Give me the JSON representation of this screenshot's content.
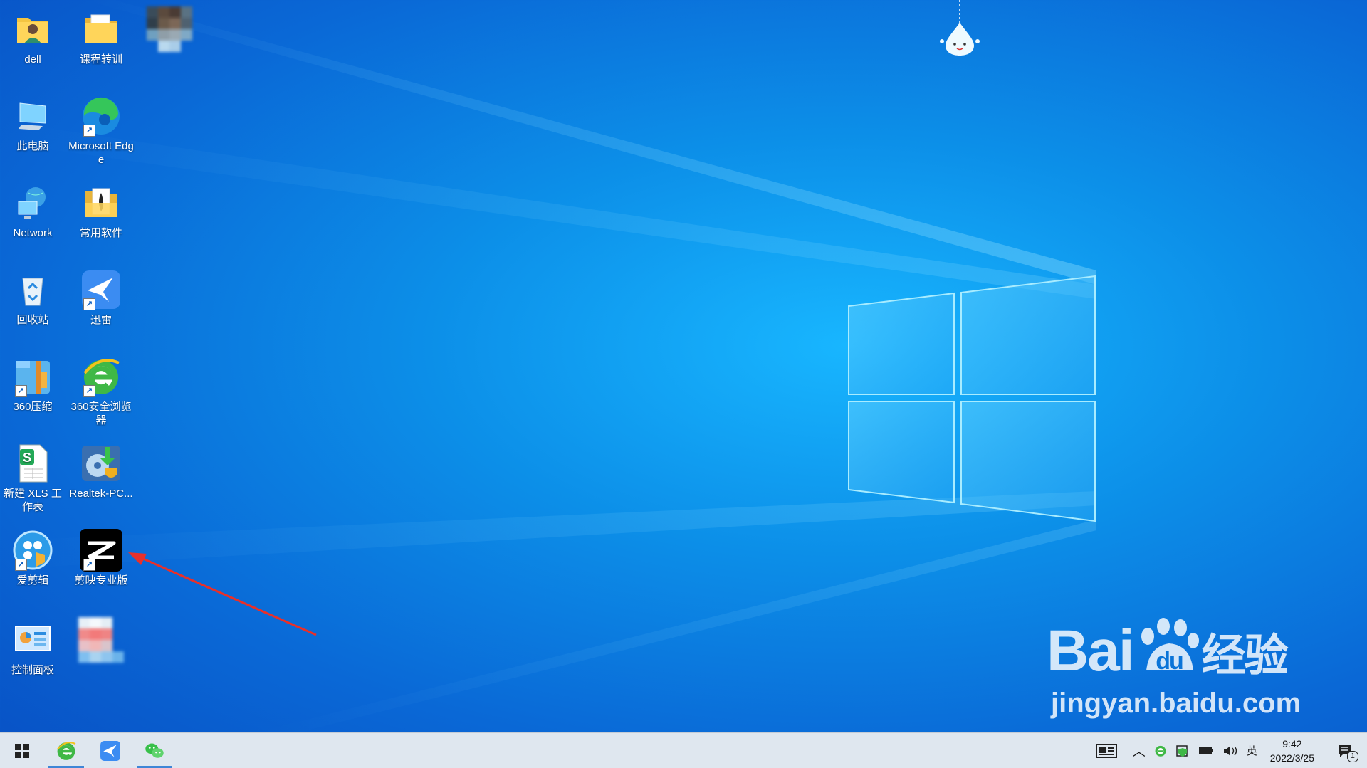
{
  "desktop": {
    "icons": [
      {
        "label": "dell",
        "icon": "user-folder-icon"
      },
      {
        "label": "课程转训",
        "icon": "folder-icon"
      },
      {
        "label": "",
        "icon": "blurred-image-icon"
      },
      {
        "label": "此电脑",
        "icon": "computer-icon"
      },
      {
        "label": "Microsoft Edge",
        "icon": "edge-icon"
      },
      {
        "label": "Network",
        "icon": "network-icon"
      },
      {
        "label": "常用软件",
        "icon": "folder-icon"
      },
      {
        "label": "回收站",
        "icon": "recycle-bin-icon"
      },
      {
        "label": "迅雷",
        "icon": "xunlei-icon"
      },
      {
        "label": "360压缩",
        "icon": "360zip-icon"
      },
      {
        "label": "360安全浏览器",
        "icon": "360browser-icon"
      },
      {
        "label": "新建 XLS 工作表",
        "icon": "spreadsheet-icon"
      },
      {
        "label": "Realtek-PC...",
        "icon": "realtek-icon"
      },
      {
        "label": "爱剪辑",
        "icon": "aijianji-icon"
      },
      {
        "label": "剪映专业版",
        "icon": "capcut-icon"
      },
      {
        "label": "控制面板",
        "icon": "control-panel-icon"
      },
      {
        "label": "",
        "icon": "blurred-image-icon"
      }
    ]
  },
  "watermark": {
    "brand": "Bai",
    "brand_tail": "经验",
    "url": "jingyan.baidu.com"
  },
  "taskbar": {
    "pinned": [
      "start-icon",
      "360browser-icon",
      "xunlei-icon",
      "wechat-icon"
    ],
    "tray": {
      "ime": "英",
      "time": "9:42",
      "date": "2022/3/25",
      "notification_count": "1"
    }
  },
  "colors": {
    "desktop_blue": "#0c8fe8",
    "taskbar_bg": "#dfe7ef",
    "annotation_red": "#e8302a"
  }
}
